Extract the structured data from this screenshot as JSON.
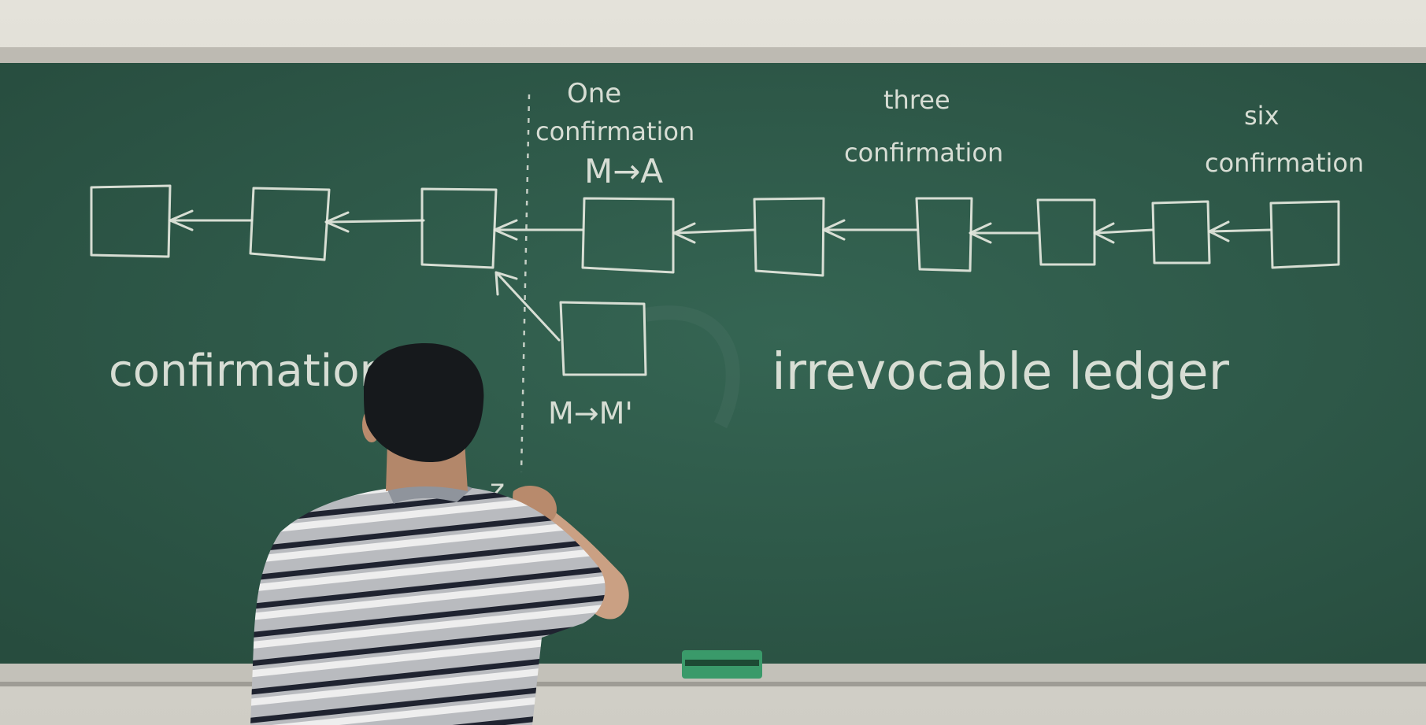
{
  "board": {
    "colors": {
      "board": "#2f5a4a",
      "chalk": "#e6e9e0",
      "frame": "#bfbdb4",
      "wall": "#d9d7cf",
      "eraser": "#3a9a6a"
    },
    "labels": {
      "one_line1": "One",
      "one_line2": "confirmation",
      "one_mapping": "M→A",
      "three_line1": "three",
      "three_line2": "confirmation",
      "six_line1": "six",
      "six_line2": "confirmation",
      "fork_mapping": "M→M'",
      "left_word": "confirmation",
      "right_phrase": "irrevocable ledger",
      "partial_mark": "z"
    }
  }
}
